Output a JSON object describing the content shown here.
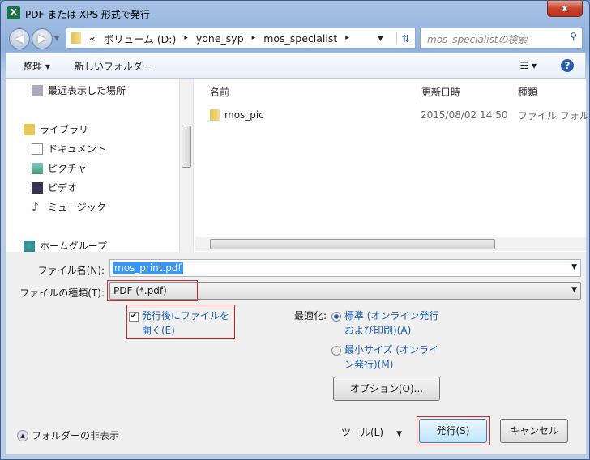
{
  "window": {
    "title": "PDF または XPS 形式で発行",
    "app_icon": "X",
    "close": "x"
  },
  "address": {
    "items": [
      "«",
      "ボリューム (D:)",
      "yone_syp",
      "mos_specialist"
    ],
    "separator": "▸",
    "search_placeholder": "mos_specialistの検索"
  },
  "toolbar": {
    "organize": "整理 ▾",
    "new_folder": "新しいフォルダー",
    "view": "☷ ▾",
    "help": "?"
  },
  "nav": {
    "recent": "最近表示した場所",
    "library": "ライブラリ",
    "documents": "ドキュメント",
    "pictures": "ピクチャ",
    "videos": "ビデオ",
    "music": "ミュージック",
    "homegroup": "ホームグループ"
  },
  "list": {
    "columns": [
      "名前",
      "更新日時",
      "種類"
    ],
    "rows": [
      {
        "name": "mos_pic",
        "date": "2015/08/02 14:50",
        "type": "ファイル フォル"
      }
    ]
  },
  "form": {
    "filename_label": "ファイル名(N):",
    "filename_value": "mos_print.pdf",
    "filetype_label": "ファイルの種類(T):",
    "filetype_value": "PDF (*.pdf)",
    "open_after": {
      "line1": "発行後にファイルを",
      "line2": "開く(E)",
      "checked": true
    },
    "optimize_label": "最適化:",
    "opt_standard": {
      "line1": "標準 (オンライン発行",
      "line2": "および印刷)(A)",
      "selected": true
    },
    "opt_min": {
      "line1": "最小サイズ (オンライ",
      "line2": "ン発行)(M)",
      "selected": false
    },
    "options_button": "オプション(O)...",
    "hide_folders": "フォルダーの非表示",
    "tools": "ツール(L)",
    "publish": "発行(S)",
    "cancel": "キャンセル"
  }
}
